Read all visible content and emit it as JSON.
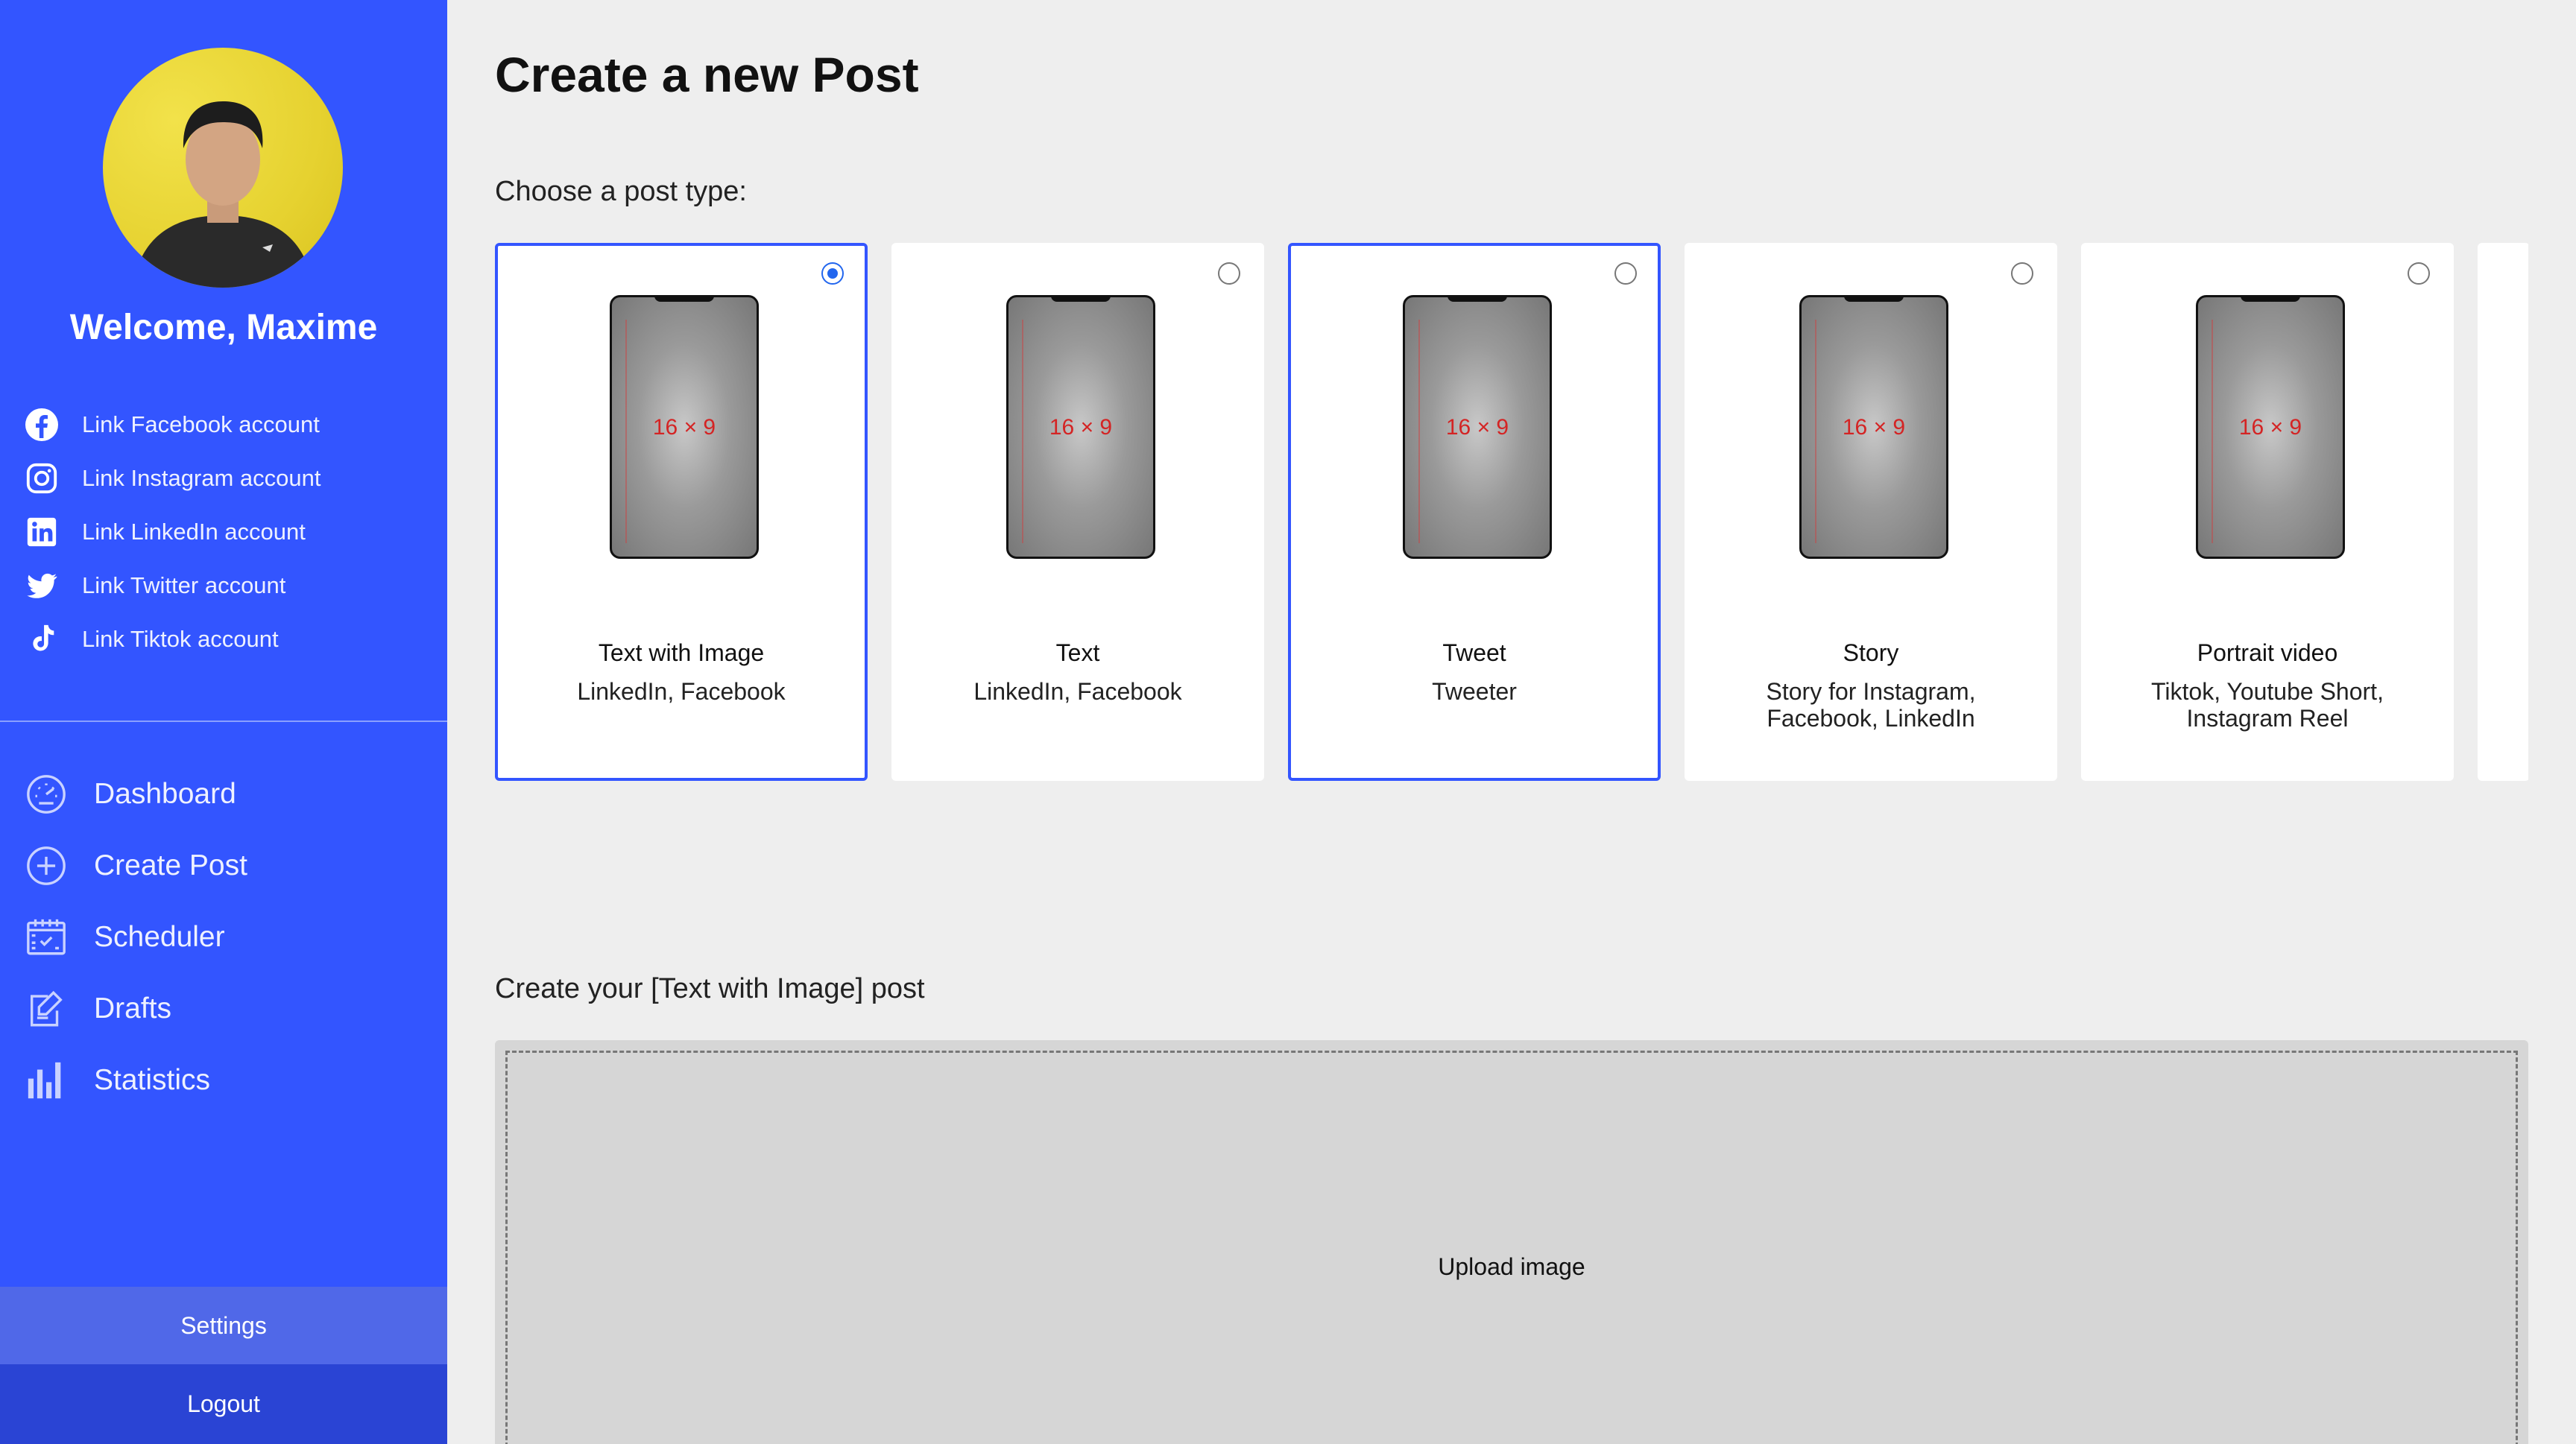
{
  "user": {
    "welcome": "Welcome, Maxime"
  },
  "links": [
    {
      "label": "Link Facebook account",
      "icon": "facebook-icon"
    },
    {
      "label": "Link Instagram account",
      "icon": "instagram-icon"
    },
    {
      "label": "Link LinkedIn account",
      "icon": "linkedin-icon"
    },
    {
      "label": "Link Twitter account",
      "icon": "twitter-icon"
    },
    {
      "label": "Link Tiktok account",
      "icon": "tiktok-icon"
    }
  ],
  "nav": [
    {
      "label": "Dashboard",
      "icon": "gauge-icon"
    },
    {
      "label": "Create Post",
      "icon": "plus-circle-icon"
    },
    {
      "label": "Scheduler",
      "icon": "calendar-icon"
    },
    {
      "label": "Drafts",
      "icon": "edit-icon"
    },
    {
      "label": "Statistics",
      "icon": "bar-chart-icon"
    }
  ],
  "footer": {
    "settings": "Settings",
    "logout": "Logout"
  },
  "main": {
    "title": "Create a new Post",
    "choose_label": "Choose a post type:",
    "create_label": "Create your [Text with Image] post",
    "upload_label": "Upload image"
  },
  "post_types": [
    {
      "title": "Text with Image",
      "sub": "LinkedIn, Facebook",
      "ratio": "16 × 9",
      "checked": true,
      "selected": true
    },
    {
      "title": "Text",
      "sub": "LinkedIn, Facebook",
      "ratio": "16 × 9",
      "checked": false,
      "selected": false
    },
    {
      "title": "Tweet",
      "sub": "Tweeter",
      "ratio": "16 × 9",
      "checked": false,
      "selected": true
    },
    {
      "title": "Story",
      "sub": "Story for Instagram, Facebook, LinkedIn",
      "ratio": "16 × 9",
      "checked": false,
      "selected": false
    },
    {
      "title": "Portrait video",
      "sub": "Tiktok, Youtube Short, Instagram Reel",
      "ratio": "16 × 9",
      "checked": false,
      "selected": false
    }
  ],
  "colors": {
    "sidebar": "#3355ff",
    "settings_bg": "#5068e8",
    "logout_bg": "#2a44d4",
    "accent": "#3355ff",
    "ratio_text": "#d42424"
  }
}
